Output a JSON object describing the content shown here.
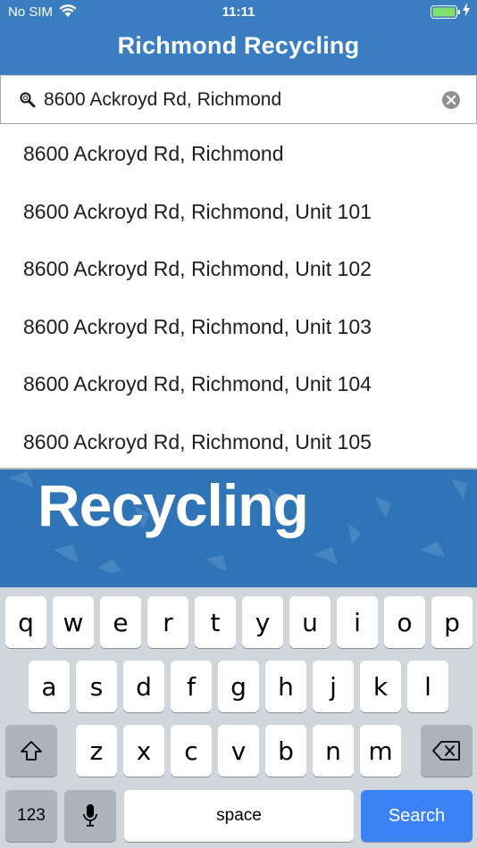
{
  "status": {
    "carrier": "No SIM",
    "time": "11:11",
    "wifi_icon": "wifi-icon",
    "battery_icon": "battery-icon",
    "charging_icon": "charging-bolt-icon"
  },
  "header": {
    "title": "Richmond Recycling"
  },
  "search": {
    "value": "8600 Ackroyd Rd, Richmond",
    "search_icon": "magnifier-icon",
    "clear_icon": "clear-icon"
  },
  "suggestions": [
    "8600 Ackroyd Rd, Richmond",
    "8600 Ackroyd Rd, Richmond, Unit 101",
    "8600 Ackroyd Rd, Richmond, Unit 102",
    "8600 Ackroyd Rd, Richmond, Unit 103",
    "8600 Ackroyd Rd, Richmond, Unit 104",
    "8600 Ackroyd Rd, Richmond, Unit 105"
  ],
  "banner": {
    "text": "Recycling"
  },
  "keyboard": {
    "row1": [
      "q",
      "w",
      "e",
      "r",
      "t",
      "y",
      "u",
      "i",
      "o",
      "p"
    ],
    "row2": [
      "a",
      "s",
      "d",
      "f",
      "g",
      "h",
      "j",
      "k",
      "l"
    ],
    "row3": [
      "z",
      "x",
      "c",
      "v",
      "b",
      "n",
      "m"
    ],
    "numbers_label": "123",
    "space_label": "space",
    "search_label": "Search",
    "shift_icon": "shift-icon",
    "backspace_icon": "backspace-icon",
    "mic_icon": "microphone-icon"
  },
  "colors": {
    "header_blue": "#3a7ec1",
    "banner_blue": "#2f74b7",
    "search_key_blue": "#3a82f6",
    "keyboard_bg": "#d1d6dd"
  }
}
